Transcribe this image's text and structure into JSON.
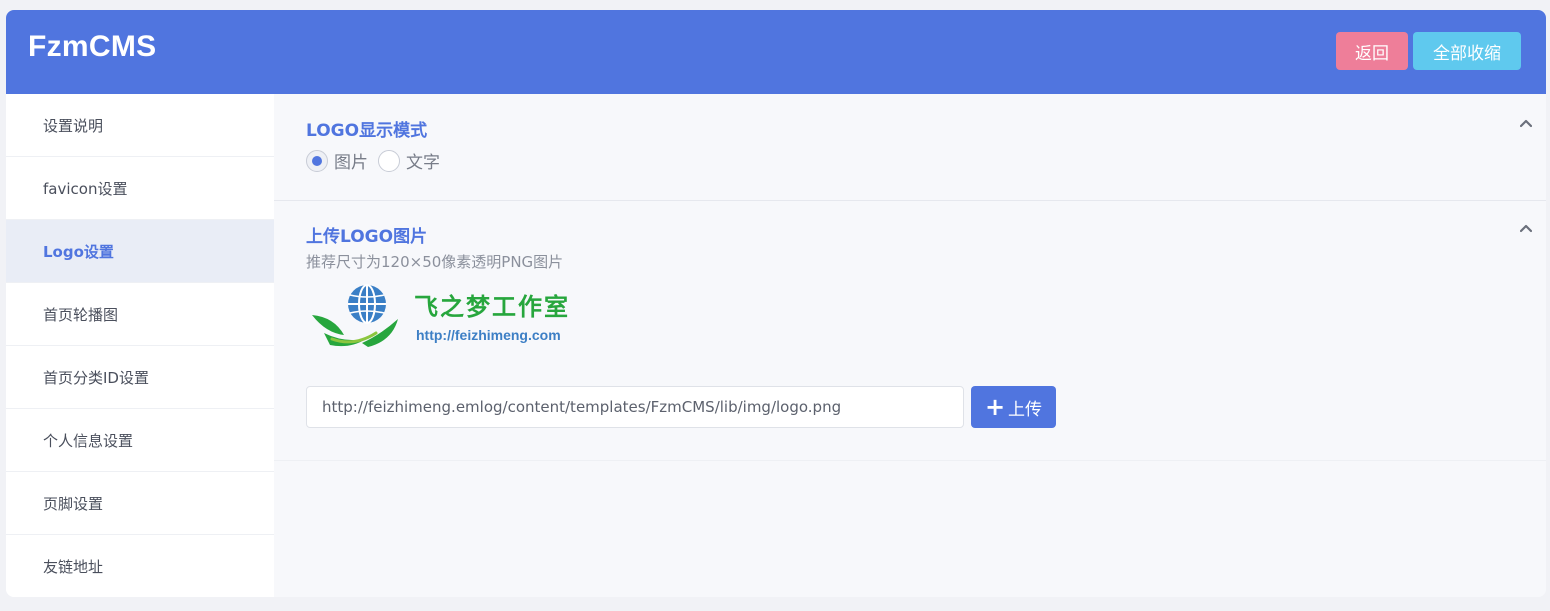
{
  "app": {
    "brand": "FzmCMS"
  },
  "header": {
    "back_label": "返回",
    "collapse_all_label": "全部收缩"
  },
  "sidebar": {
    "items": [
      {
        "label": "设置说明",
        "active": false
      },
      {
        "label": "favicon设置",
        "active": false
      },
      {
        "label": "Logo设置",
        "active": true
      },
      {
        "label": "首页轮播图",
        "active": false
      },
      {
        "label": "首页分类ID设置",
        "active": false
      },
      {
        "label": "个人信息设置",
        "active": false
      },
      {
        "label": "页脚设置",
        "active": false
      },
      {
        "label": "友链地址",
        "active": false
      }
    ]
  },
  "main": {
    "logo_mode": {
      "title": "LOGO显示模式",
      "options": [
        {
          "label": "图片",
          "checked": true
        },
        {
          "label": "文字",
          "checked": false
        }
      ]
    },
    "upload_logo": {
      "title": "上传LOGO图片",
      "hint": "推荐尺寸为120×50像素透明PNG图片",
      "preview": {
        "name_cn": "飞之梦工作室",
        "url_text": "http://feizhimeng.com"
      },
      "input_value": "http://feizhimeng.emlog/content/templates/FzmCMS/lib/img/logo.png",
      "upload_label": "上传",
      "upload_icon": "plus-icon"
    }
  },
  "colors": {
    "accent": "#5075df",
    "back_button": "#ee7e99",
    "collapse_button": "#5fc9ee",
    "logo_green": "#27a63d",
    "logo_blue": "#3d7fc5"
  }
}
